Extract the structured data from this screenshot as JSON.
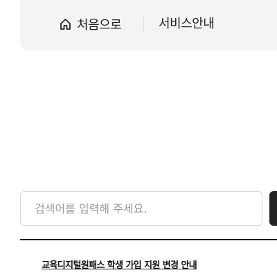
{
  "breadcrumb": {
    "home_icon": "home-icon",
    "home_label": "처음으로",
    "current_label": "서비스안내"
  },
  "search": {
    "placeholder": "검색어를 입력해 주세요.",
    "value": ""
  },
  "notices": [
    {
      "title": "교육디지털원패스 학생 가입 지원 변경 안내"
    }
  ],
  "colors": {
    "breadcrumb_bg": "#f4f4f4",
    "text_primary": "#222222",
    "placeholder": "#9a9a9a",
    "search_button": "#222222",
    "divider": "#111111"
  }
}
